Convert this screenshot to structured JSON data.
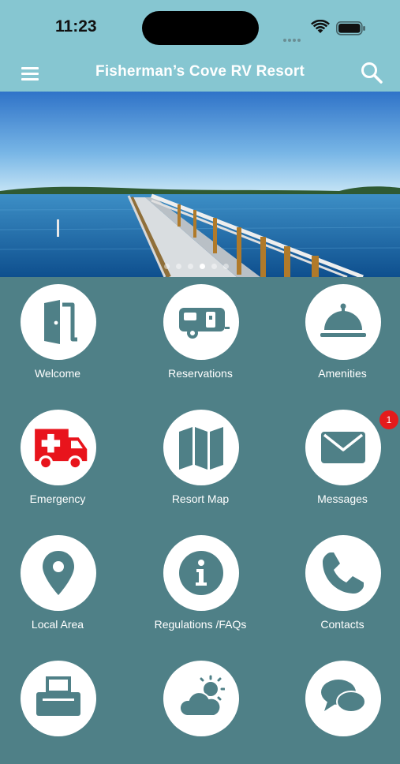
{
  "status_bar": {
    "time": "11:23"
  },
  "header": {
    "title": "Fisherman’s Cove RV Resort"
  },
  "carousel": {
    "slide_count": 6,
    "active_index": 3
  },
  "tiles": [
    {
      "label": "Welcome",
      "icon": "door-icon"
    },
    {
      "label": "Reservations",
      "icon": "camper-trailer-icon"
    },
    {
      "label": "Amenities",
      "icon": "service-bell-icon"
    },
    {
      "label": "Emergency",
      "icon": "ambulance-icon"
    },
    {
      "label": "Resort Map",
      "icon": "map-icon"
    },
    {
      "label": "Messages",
      "icon": "envelope-icon",
      "badge": "1"
    },
    {
      "label": "Local Area",
      "icon": "location-pin-icon"
    },
    {
      "label": "Regulations /FAQs",
      "icon": "info-icon"
    },
    {
      "label": "Contacts",
      "icon": "phone-icon"
    },
    {
      "label": "",
      "icon": "fax-printer-icon"
    },
    {
      "label": "",
      "icon": "weather-icon"
    },
    {
      "label": "",
      "icon": "chat-bubbles-icon"
    }
  ],
  "colors": {
    "header": "#86c6d1",
    "background": "#4f8087",
    "icon": "#4f8087",
    "emergency": "#e8141c",
    "badge": "#e41b1b"
  }
}
